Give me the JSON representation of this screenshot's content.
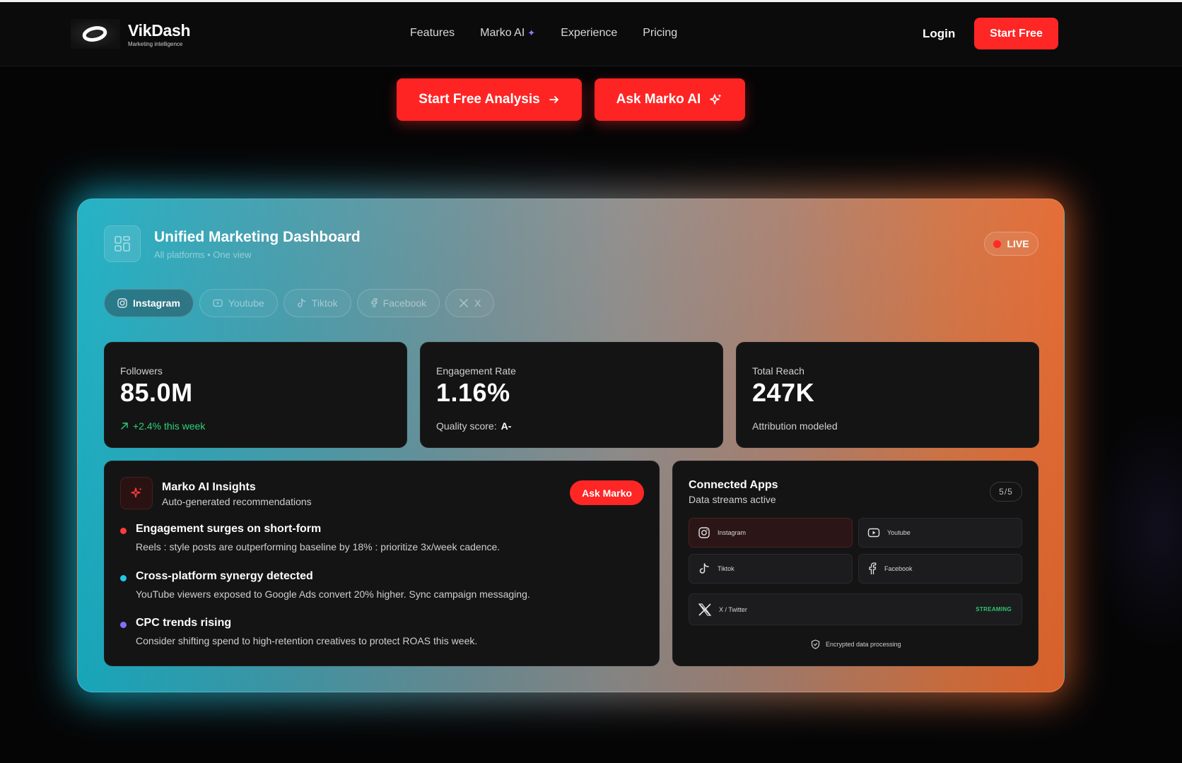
{
  "brand": {
    "name": "VikDash",
    "tagline": "Marketing intelligence"
  },
  "nav": {
    "links": [
      "Features",
      "Marko AI",
      "Experience",
      "Pricing"
    ],
    "login": "Login",
    "start_free": "Start Free"
  },
  "hero": {
    "primary_label": "Start Free Analysis",
    "secondary_label": "Ask Marko AI"
  },
  "dashboard": {
    "title": "Unified Marketing Dashboard",
    "subtitle": "All platforms • One view",
    "live_label": "LIVE",
    "tabs": [
      "Instagram",
      "Youtube",
      "Tiktok",
      "Facebook",
      "X"
    ],
    "active_tab": "Instagram",
    "stats": [
      {
        "label": "Followers",
        "value": "85.0M",
        "foot": "+2.4% this week"
      },
      {
        "label": "Engagement Rate",
        "value": "1.16%",
        "foot_prefix": "Quality score:",
        "foot_value": "A-"
      },
      {
        "label": "Total Reach",
        "value": "247K",
        "foot": "Attribution modeled"
      }
    ],
    "insights": {
      "title": "Marko AI Insights",
      "subtitle": "Auto-generated recommendations",
      "ask_label": "Ask Marko",
      "items": [
        {
          "title": "Engagement surges on short-form",
          "body": "Reels : style posts are outperforming baseline by 18% : prioritize 3x/week cadence.",
          "color": "#ff3b3b"
        },
        {
          "title": "Cross-platform synergy detected",
          "body": "YouTube viewers exposed to Google Ads convert 20% higher. Sync campaign messaging.",
          "color": "#22c8e8"
        },
        {
          "title": "CPC trends rising",
          "body": "Consider shifting spend to high-retention creatives to protect ROAS this week.",
          "color": "#8b6bff"
        }
      ]
    },
    "apps": {
      "title": "Connected Apps",
      "subtitle": "Data streams active",
      "count": "5/5",
      "items": [
        "Instagram",
        "Youtube",
        "Tiktok",
        "Facebook",
        "X / Twitter"
      ],
      "streaming_label": "STREAMING",
      "footer": "Encrypted data processing"
    }
  },
  "colors": {
    "accent": "#ff2626",
    "green": "#2ed17a",
    "bg": "#050506"
  }
}
